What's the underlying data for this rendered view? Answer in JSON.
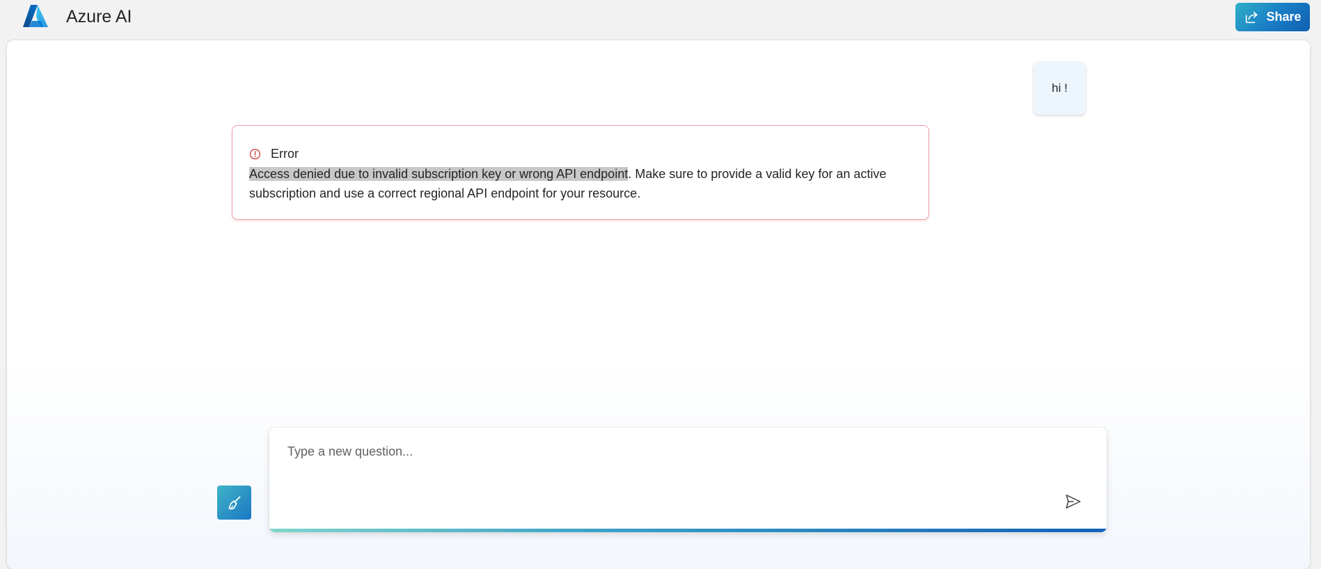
{
  "header": {
    "app_title": "Azure AI",
    "share_label": "Share",
    "logo_icon": "azure-logo-icon"
  },
  "chat": {
    "messages": [
      {
        "role": "user",
        "text": "hi !"
      }
    ],
    "error": {
      "title": "Error",
      "highlighted_text": "Access denied due to invalid subscription key or wrong API endpoint",
      "rest_text": ". Make sure to provide a valid key for an active subscription and use a correct regional API endpoint for your resource.",
      "icon": "error-circle-icon"
    }
  },
  "composer": {
    "placeholder": "Type a new question...",
    "value": "",
    "clear_icon": "broom-icon",
    "send_icon": "send-icon"
  },
  "colors": {
    "accent": "#1a77c4",
    "error_border": "#e8a0a8",
    "error_icon": "#d13438",
    "user_bubble": "#edf5fd"
  }
}
